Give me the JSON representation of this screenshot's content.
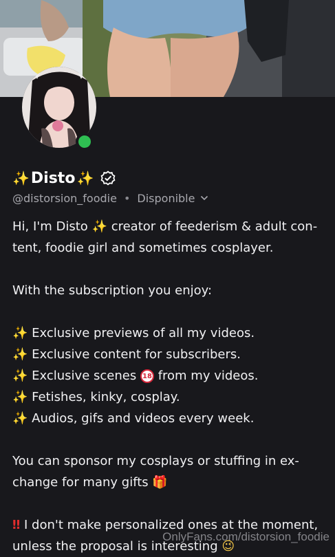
{
  "profile": {
    "name_sparkle_left": "✨",
    "display_name": "Disto",
    "name_sparkle_right": "✨",
    "verified_icon": "verified-badge-icon",
    "handle": "@distorsion_foodie",
    "separator": "•",
    "status": "Disponible",
    "online_color": "#2fbf52"
  },
  "bio": {
    "intro_a": "Hi, I'm Disto",
    "intro_emoji": "✨",
    "intro_b": "creator of feederism & adult con-",
    "intro_c": "tent, foodie girl and sometimes cosplayer.",
    "subscription_heading": "With the subscription you enjoy:",
    "bullet_emoji": "✨",
    "item1": "Exclusive previews of all my videos.",
    "item2": "Exclusive content for subscribers.",
    "item3_a": "Exclusive scenes",
    "item3_emoji": "18",
    "item3_b": "from my videos.",
    "item4": "Fetishes, kinky, cosplay.",
    "item5": "Audios, gifs and videos every week.",
    "sponsor_a": "You can sponsor my cosplays or stuffing in ex-",
    "sponsor_b": "change for many gifts",
    "gift_emoji": "🎁",
    "warning_emoji": "‼",
    "warning_a": "I don't make personalized ones at the moment,",
    "warning_b": "unless the proposal is interesting",
    "smile_emoji": "😉"
  },
  "watermark": "OnlyFans.com/distorsion_foodie",
  "colors": {
    "background": "#18181c",
    "accent_sparkle": "#f7c948",
    "muted_text": "#a8a8ae"
  }
}
